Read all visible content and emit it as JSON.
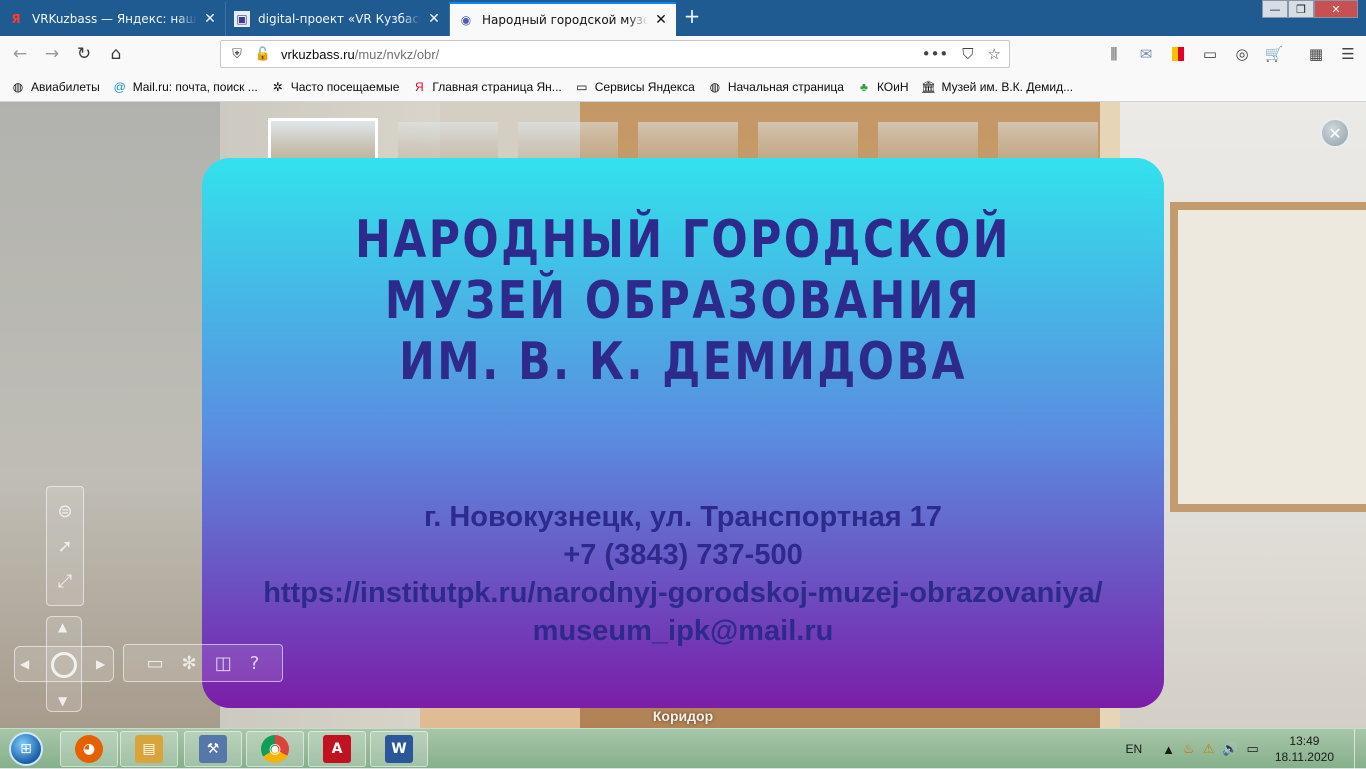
{
  "browser": {
    "tabs": [
      {
        "title": "VRKuzbass — Яндекс: нашлось",
        "favicon": "Я",
        "active": false
      },
      {
        "title": "digital-проект «VR Кузбасс» —",
        "favicon": "▣",
        "active": false
      },
      {
        "title": "Народный городской музей о",
        "favicon": "◉",
        "active": true
      }
    ],
    "new_tab_label": "+",
    "window_controls": {
      "minimize": "—",
      "maximize": "❐",
      "close": "✕"
    },
    "nav": {
      "back": "←",
      "forward": "→",
      "reload": "↻",
      "home": "⌂"
    },
    "url": {
      "host": "vrkuzbass.ru",
      "path": "/muz/nvkz/obr/"
    },
    "url_actions": {
      "more": "•••",
      "pocket": "⛉",
      "bookmark": "☆"
    },
    "toolbar_icons": [
      "library-icon",
      "mail-icon",
      "bookmark-ribbon-icon",
      "reader-icon",
      "account-icon",
      "cart-icon",
      "extensions-icon",
      "menu-icon"
    ]
  },
  "bookmarks": [
    {
      "label": "Авиабилеты",
      "icon": "globe-icon",
      "glyph": "◍"
    },
    {
      "label": "Mail.ru: почта, поиск ...",
      "icon": "mail-ru-icon",
      "glyph": "@"
    },
    {
      "label": "Часто посещаемые",
      "icon": "gear-icon",
      "glyph": "✲"
    },
    {
      "label": "Главная страница Ян...",
      "icon": "yandex-icon",
      "glyph": "Я"
    },
    {
      "label": "Сервисы Яндекса",
      "icon": "folder-icon",
      "glyph": "▭"
    },
    {
      "label": "Начальная страница",
      "icon": "globe-icon",
      "glyph": "◍"
    },
    {
      "label": "КОиН",
      "icon": "koin-icon",
      "glyph": "♣"
    },
    {
      "label": "Музей им. В.К. Демид...",
      "icon": "museum-icon",
      "glyph": "🏛"
    }
  ],
  "tour": {
    "thumbnails_count": 7,
    "active_thumbnail": 1,
    "close_label": "✕",
    "museum_title": [
      "НАРОДНЫЙ ГОРОДСКОЙ",
      "МУЗЕЙ ОБРАЗОВАНИЯ",
      "ИМ. В. К. ДЕМИДОВА"
    ],
    "contacts": [
      "г. Новокузнецк, ул. Транспортная 17",
      "+7 (3843) 737-500",
      "https://institutpk.ru/narodnyj-gorodskoj-muzej-obrazovaniya/",
      "museum_ipk@mail.ru"
    ],
    "scene_name": "Коридор",
    "frame_colors": {
      "top": "#32e2ec",
      "middle": "#5a8de0",
      "bottom": "#7b1ea8"
    },
    "text_color": "#2d2a8c"
  },
  "taskbar": {
    "start_label": "⊞",
    "apps": [
      {
        "name": "firefox",
        "color": "#e66000",
        "glyph": "◕"
      },
      {
        "name": "file-explorer",
        "color": "#d9a53a",
        "glyph": "▤"
      },
      {
        "name": "tool",
        "color": "#5577aa",
        "glyph": "⚒"
      },
      {
        "name": "chrome",
        "color": "#2f9e44",
        "glyph": "◉"
      },
      {
        "name": "acrobat",
        "color": "#c1121f",
        "glyph": "A"
      },
      {
        "name": "word",
        "color": "#2b579a",
        "glyph": "W"
      }
    ],
    "language": "EN",
    "tray_icons": [
      "▲",
      "♨",
      "⚠",
      "🔊",
      "▭"
    ],
    "time": "13:49",
    "date": "18.11.2020"
  }
}
